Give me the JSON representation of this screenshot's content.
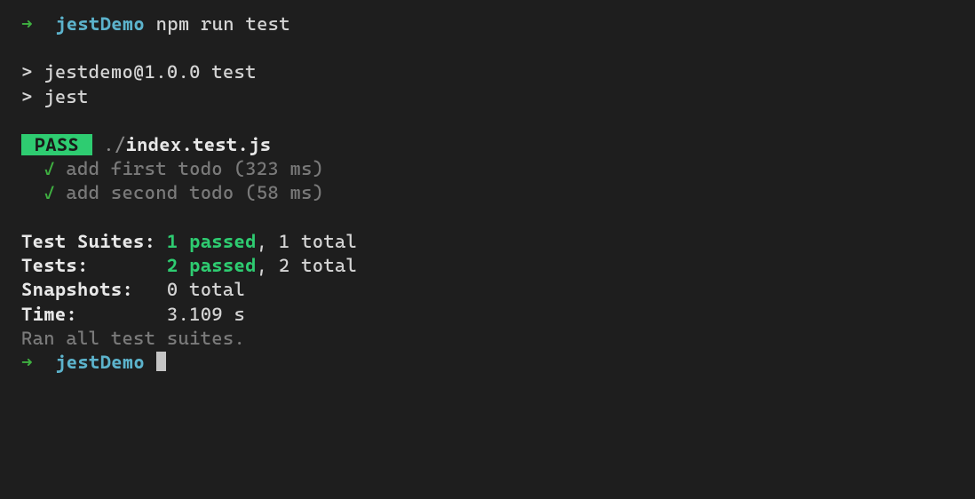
{
  "prompt1": {
    "arrow": "➜",
    "dir": "jestDemo",
    "command": "npm run test",
    "space": "  "
  },
  "npm_out": {
    "line1": "> jestdemo@1.0.0 test",
    "line2": "> jest"
  },
  "pass": {
    "badge": " PASS ",
    "path_prefix": " ./",
    "file": "index.test.js"
  },
  "tests_list": {
    "prefix": "  ",
    "check": "✓",
    "t1": " add first todo (323 ms)",
    "t2": " add second todo (58 ms)"
  },
  "summary": {
    "suites_label": "Test Suites: ",
    "suites_passed": "1 passed",
    "suites_rest": ", 1 total",
    "tests_label": "Tests:       ",
    "tests_passed": "2 passed",
    "tests_rest": ", 2 total",
    "snapshots_label": "Snapshots:   ",
    "snapshots_rest": "0 total",
    "time_label": "Time:        ",
    "time_rest": "3.109 s",
    "ran": "Ran all test suites."
  },
  "prompt2": {
    "arrow": "➜",
    "dir": "jestDemo",
    "space": "  "
  }
}
